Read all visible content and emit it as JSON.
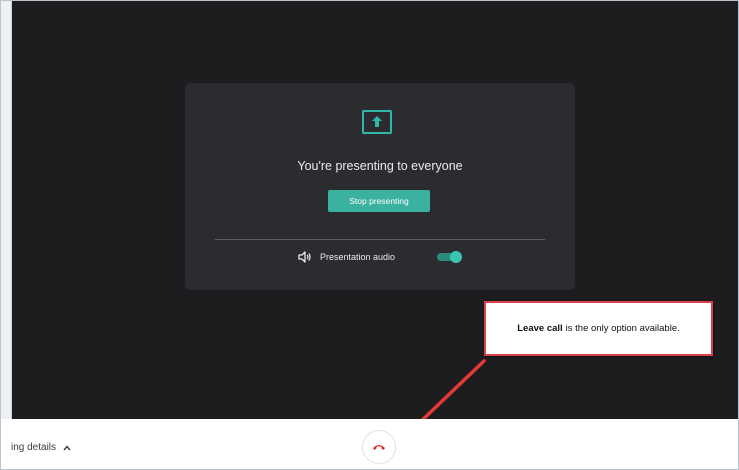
{
  "presentation": {
    "title": "You're presenting to everyone",
    "stop_label": "Stop presenting",
    "audio_label": "Presentation audio",
    "audio_enabled": true
  },
  "callout": {
    "bold": "Leave call",
    "text": "is the only option available."
  },
  "bottom_bar": {
    "details_label": "ing details"
  },
  "icons": {
    "present": "present-to-all-icon",
    "speaker": "speaker-icon",
    "chevron": "chevron-up-icon",
    "leave": "hang-up-phone-icon"
  },
  "colors": {
    "stage_bg": "#1d1d1f",
    "card_bg": "#2b2c2f",
    "accent_teal": "#3bb2a0",
    "leave_red": "#d93025",
    "callout_border": "#d9414a",
    "arrow_red": "#e53935"
  }
}
